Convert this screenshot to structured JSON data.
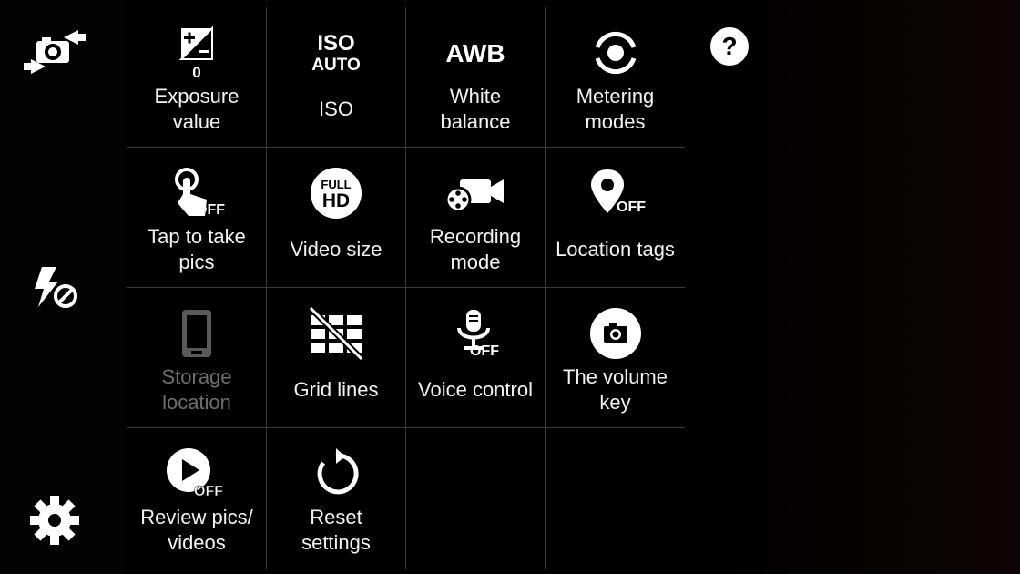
{
  "sidebar": {
    "switch_camera_icon": "camera-switch-icon",
    "flash_icon": "flash-off-icon",
    "settings_icon": "gear-icon"
  },
  "help": {
    "icon": "help-icon"
  },
  "menu": {
    "items": [
      {
        "label": "Exposure\nvalue",
        "icon": "exposure-icon",
        "value": "0",
        "enabled": true
      },
      {
        "label": "ISO",
        "icon": "iso-auto-icon",
        "icon_text_top": "ISO",
        "icon_text_bottom": "AUTO",
        "enabled": true
      },
      {
        "label": "White\nbalance",
        "icon": "awb-icon",
        "icon_text": "AWB",
        "enabled": true
      },
      {
        "label": "Metering\nmodes",
        "icon": "metering-icon",
        "enabled": true
      },
      {
        "label": "Tap to take\npics",
        "icon": "tap-to-take-off-icon",
        "badge": "OFF",
        "enabled": true
      },
      {
        "label": "Video size",
        "icon": "full-hd-icon",
        "icon_text_top": "FULL",
        "icon_text_bottom": "HD",
        "enabled": true
      },
      {
        "label": "Recording\nmode",
        "icon": "recording-mode-icon",
        "enabled": true
      },
      {
        "label": "Location tags",
        "icon": "location-off-icon",
        "badge": "OFF",
        "enabled": true
      },
      {
        "label": "Storage\nlocation",
        "icon": "phone-storage-icon",
        "enabled": false
      },
      {
        "label": "Grid lines",
        "icon": "grid-lines-off-icon",
        "enabled": true
      },
      {
        "label": "Voice control",
        "icon": "voice-control-off-icon",
        "badge": "OFF",
        "enabled": true
      },
      {
        "label": "The volume\nkey",
        "icon": "volume-key-camera-icon",
        "enabled": true
      },
      {
        "label": "Review pics/\nvideos",
        "icon": "review-off-icon",
        "badge": "OFF",
        "enabled": true
      },
      {
        "label": "Reset\nsettings",
        "icon": "reset-icon",
        "enabled": true
      }
    ]
  },
  "colors": {
    "background": "#000000",
    "divider": "#3a3a3a",
    "text": "#f2f2f2",
    "disabled": "#6e6e6e"
  }
}
